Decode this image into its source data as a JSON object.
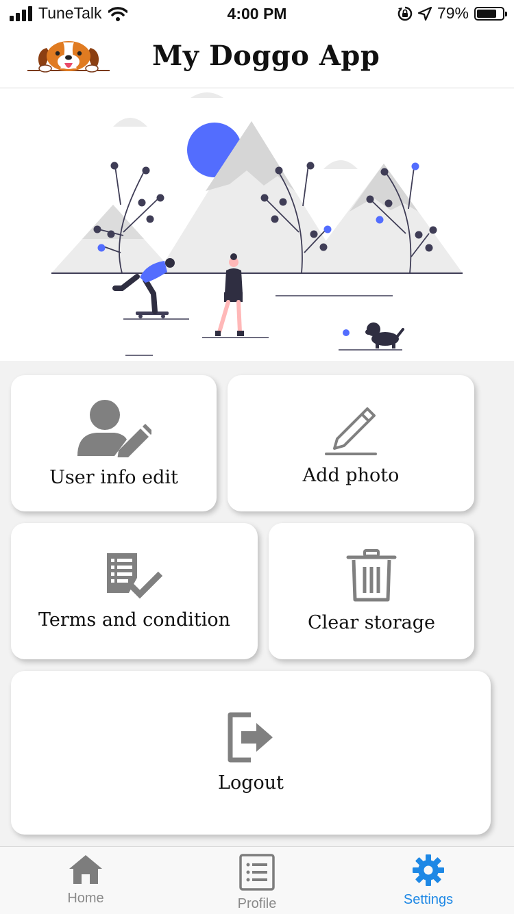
{
  "status_bar": {
    "carrier": "TuneTalk",
    "time": "4:00 PM",
    "battery_percent": "79%",
    "battery_level": 0.79
  },
  "header": {
    "title": "My Doggo App",
    "logo_icon": "beagle-dog-logo"
  },
  "hero": {
    "illustration": "mountains-park-skateboarder-walker-dog"
  },
  "tiles": [
    {
      "label": "User info edit",
      "icon": "user-edit-icon"
    },
    {
      "label": "Add photo",
      "icon": "pencil-icon"
    },
    {
      "label": "Terms and condition",
      "icon": "checklist-icon"
    },
    {
      "label": "Clear storage",
      "icon": "trash-icon"
    },
    {
      "label": "Logout",
      "icon": "logout-icon"
    }
  ],
  "tabbar": {
    "items": [
      {
        "label": "Home",
        "icon": "home-icon",
        "active": false
      },
      {
        "label": "Profile",
        "icon": "list-icon",
        "active": false
      },
      {
        "label": "Settings",
        "icon": "gear-icon",
        "active": true
      }
    ]
  },
  "colors": {
    "accent": "#1e88e5",
    "illustration_blue": "#536dfe",
    "icon_gray": "#808080",
    "background": "#f2f2f2"
  }
}
